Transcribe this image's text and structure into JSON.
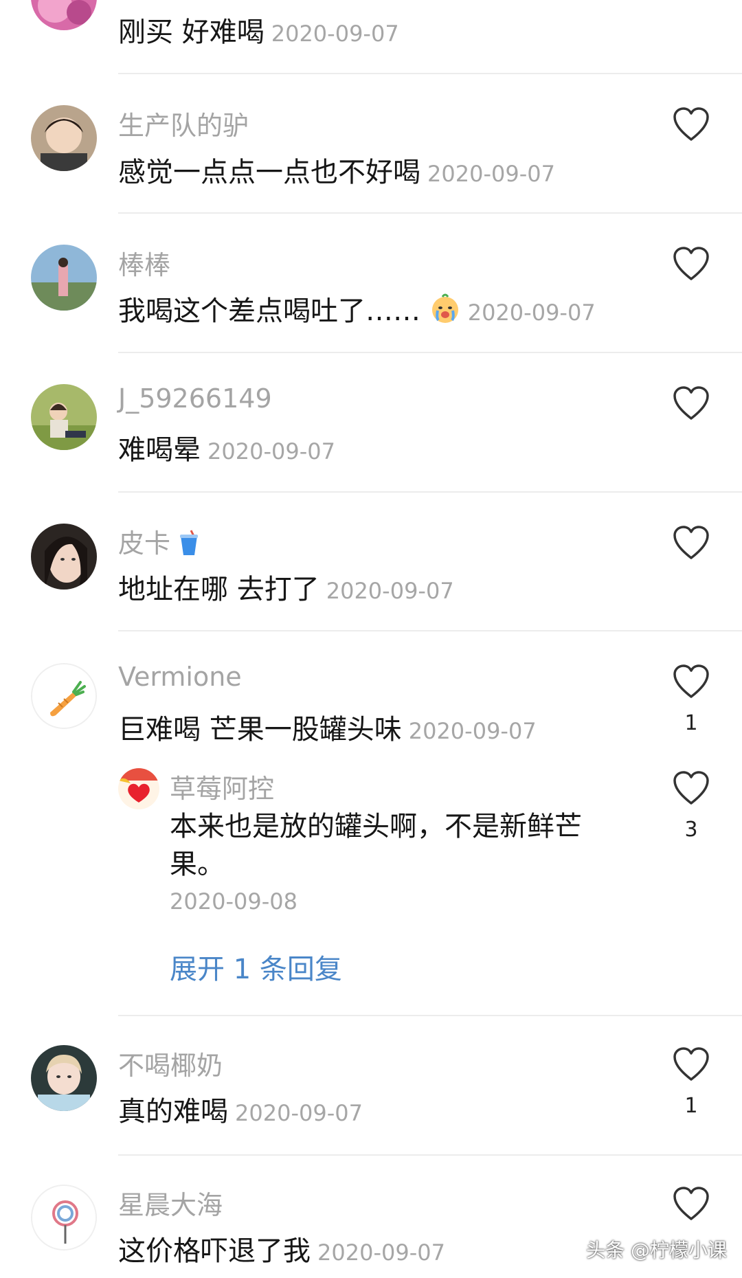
{
  "comments": [
    {
      "text": "刚买 好难喝",
      "date": "2020-09-07"
    },
    {
      "name": "生产队的驴",
      "text": "感觉一点点一点也不好喝",
      "date": "2020-09-07"
    },
    {
      "name": "棒棒",
      "text": "我喝这个差点喝吐了……",
      "date": "2020-09-07",
      "emoji": "crying-face-icon"
    },
    {
      "name": "J_59266149",
      "text": "难喝晕",
      "date": "2020-09-07"
    },
    {
      "name": "皮卡",
      "name_emoji": "cup-with-straw-icon",
      "text": "地址在哪 去打了",
      "date": "2020-09-07"
    },
    {
      "name": "Vermione",
      "text": "巨难喝 芒果一股罐头味",
      "date": "2020-09-07",
      "likes": "1"
    },
    {
      "name": "不喝椰奶",
      "text": "真的难喝",
      "date": "2020-09-07",
      "likes": "1"
    },
    {
      "name": "星晨大海",
      "text": "这价格吓退了我",
      "date": "2020-09-07"
    }
  ],
  "reply": {
    "name": "草莓阿控",
    "text": "本来也是放的罐头啊，不是新鲜芒果。",
    "date": "2020-09-08",
    "likes": "3"
  },
  "expand_label": "展开 1 条回复",
  "watermark": "头条 @柠檬小课",
  "icons": {
    "like": "heart-outline-icon"
  }
}
